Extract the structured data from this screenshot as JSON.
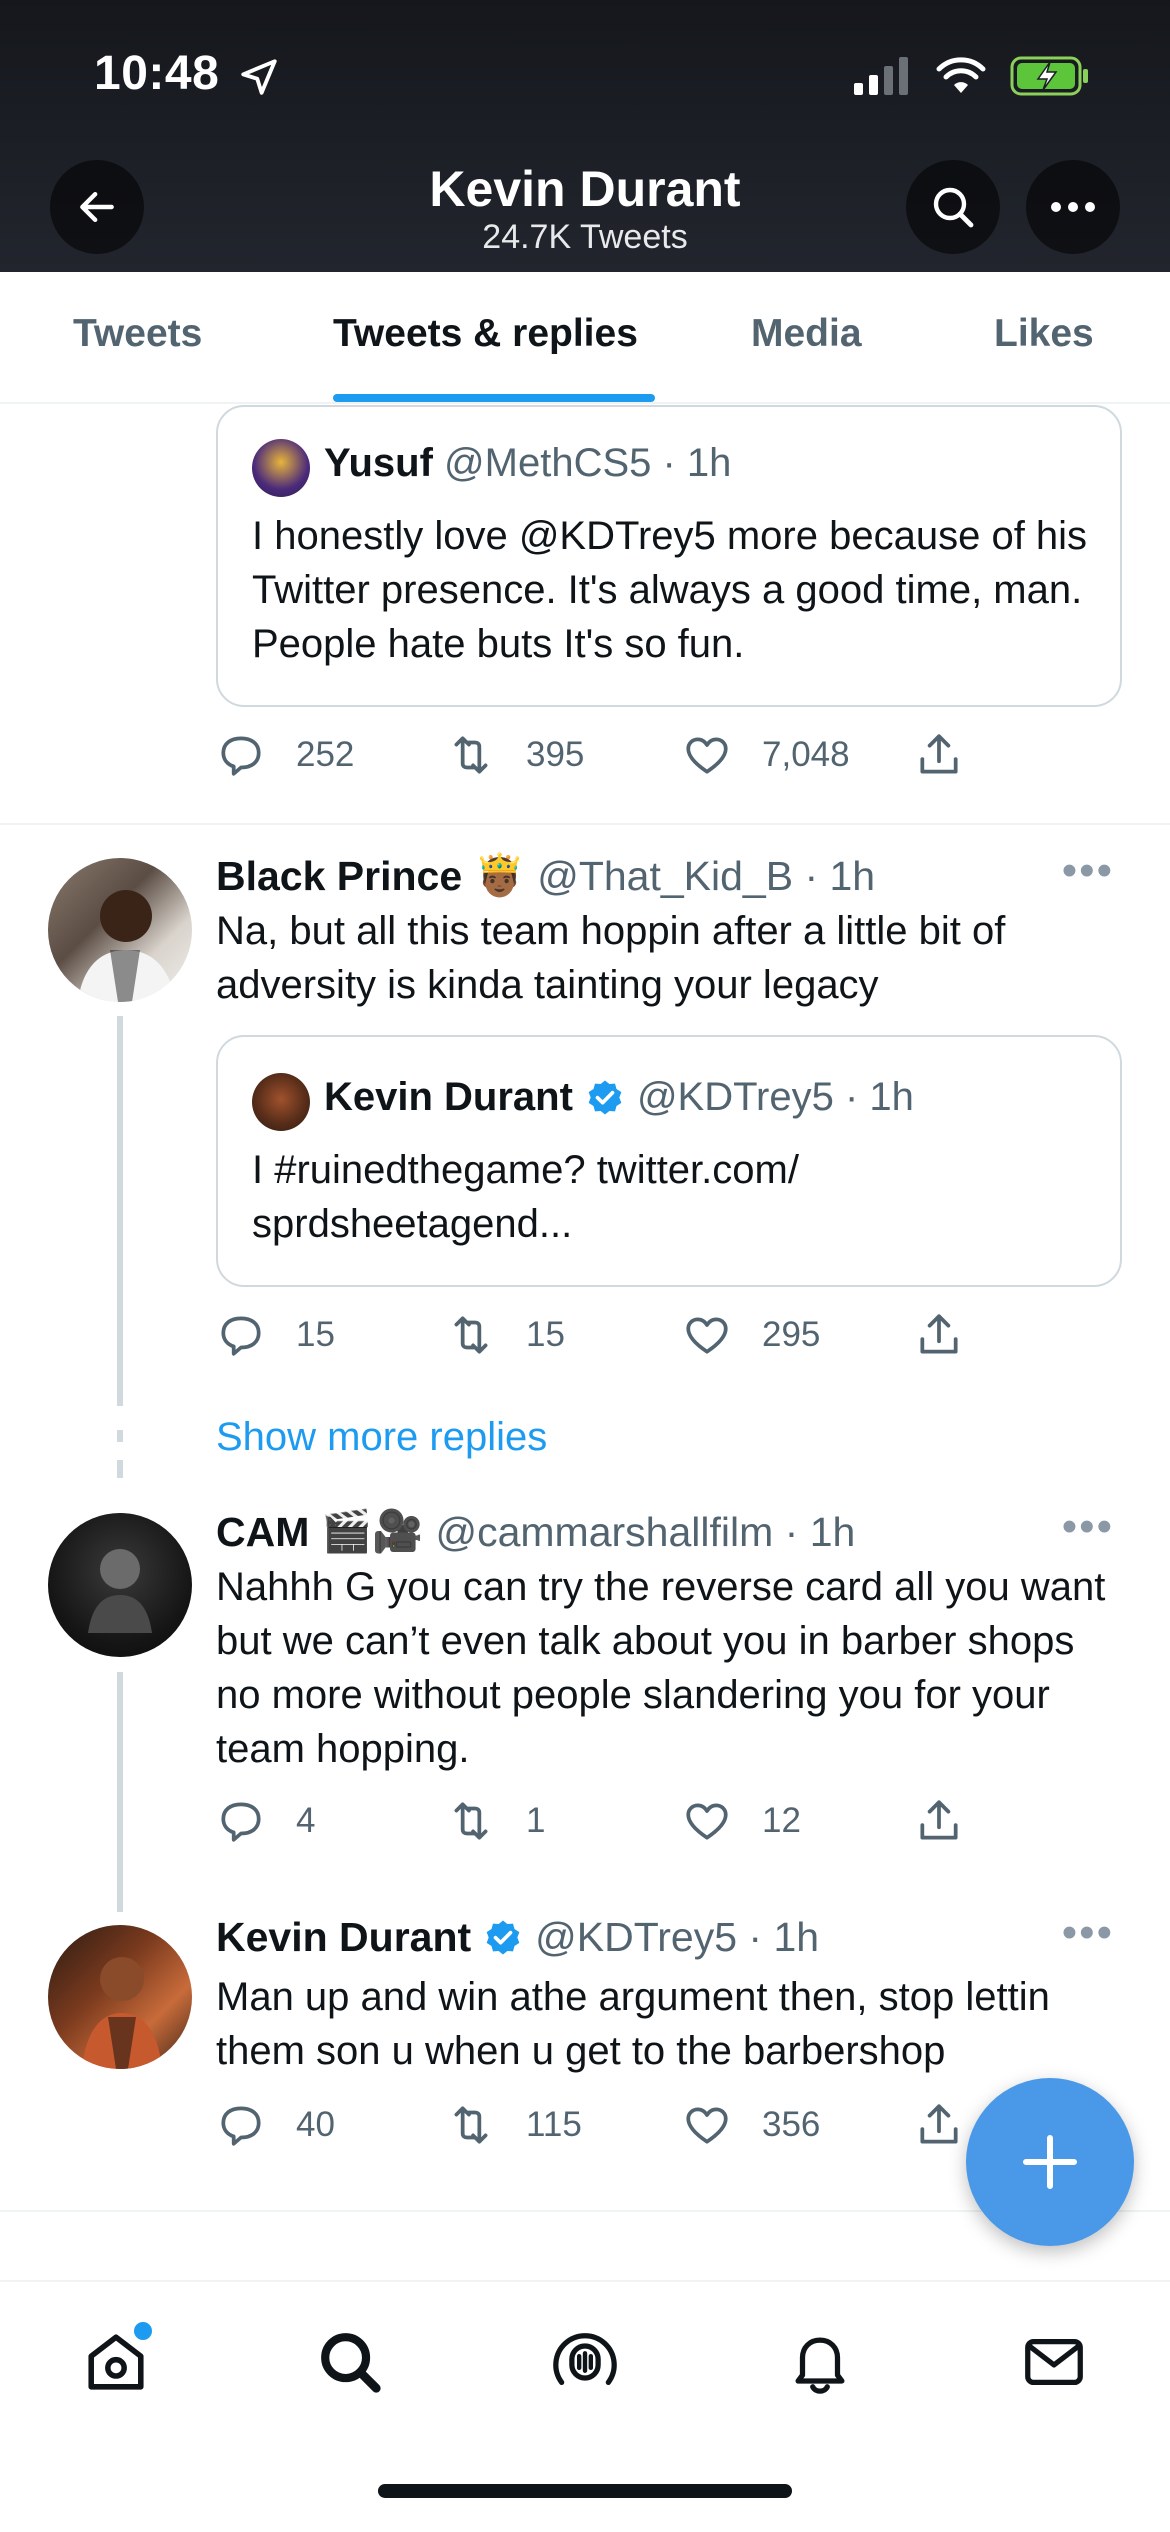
{
  "status_bar": {
    "time": "10:48"
  },
  "profile": {
    "name": "Kevin Durant",
    "tweet_count": "24.7K Tweets"
  },
  "tabs": [
    {
      "label": "Tweets"
    },
    {
      "label": "Tweets & replies",
      "active": true
    },
    {
      "label": "Media"
    },
    {
      "label": "Likes"
    }
  ],
  "tweet1": {
    "quote": {
      "name": "Yusuf",
      "handle": "@MethCS5 · 1h",
      "text": "I honestly love @KDTrey5 more because of his Twitter presence. It's always a good time, man. People hate buts It's so fun."
    },
    "replies": "252",
    "retweets": "395",
    "likes": "7,048"
  },
  "tweet2": {
    "name": "Black Prince",
    "emoji": "🤴🏾",
    "handle": "@That_Kid_B · 1h",
    "text": "Na, but all this team hoppin after a little bit of adversity is kinda tainting your legacy",
    "quote": {
      "name": "Kevin Durant",
      "handle": "@KDTrey5 · 1h",
      "text": "I #ruinedthegame? twitter.com/ sprdsheetagend..."
    },
    "replies": "15",
    "retweets": "15",
    "likes": "295"
  },
  "show_more": "Show more replies",
  "tweet3": {
    "name": "CAM",
    "emoji": "🎬🎥",
    "handle": "@cammarshallfilm · 1h",
    "text": "Nahhh G you can try the reverse card all you want but we can’t even talk about you in barber shops no more without people slandering you for your team hopping.",
    "replies": "4",
    "retweets": "1",
    "likes": "12"
  },
  "tweet4": {
    "name": "Kevin Durant",
    "handle": "@KDTrey5 · 1h",
    "text": "Man up and win athe argument then, stop lettin them son u when u get to the barbershop",
    "replies": "40",
    "retweets": "115",
    "likes": "356"
  },
  "colors": {
    "accent": "#1d9bf0",
    "fab": "#4a99e9",
    "header_bg": "#1c1f26"
  },
  "icons": [
    "location-arrow-icon",
    "signal-icon",
    "wifi-icon",
    "battery-charging-icon",
    "back-arrow-icon",
    "search-icon",
    "more-icon",
    "reply-icon",
    "retweet-icon",
    "like-icon",
    "share-icon",
    "verified-badge-icon",
    "compose-plus-icon",
    "home-icon",
    "search-nav-icon",
    "spaces-icon",
    "notifications-icon",
    "messages-icon"
  ]
}
